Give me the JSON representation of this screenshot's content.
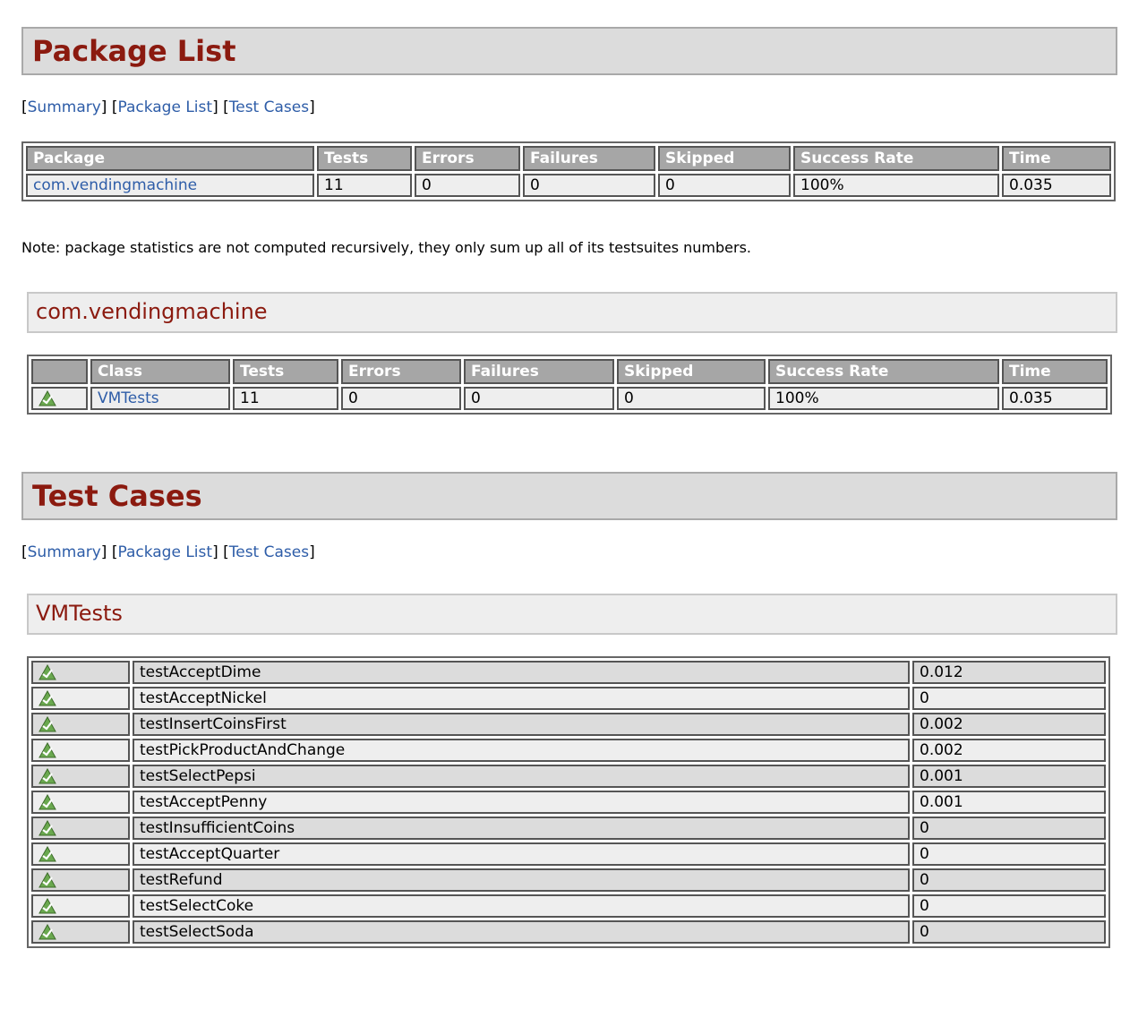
{
  "nav": {
    "summary": "Summary",
    "package_list": "Package List",
    "test_cases": "Test Cases"
  },
  "package_section": {
    "title": "Package List",
    "columns": [
      "Package",
      "Tests",
      "Errors",
      "Failures",
      "Skipped",
      "Success Rate",
      "Time"
    ],
    "rows": [
      {
        "package": "com.vendingmachine",
        "tests": "11",
        "errors": "0",
        "failures": "0",
        "skipped": "0",
        "success_rate": "100%",
        "time": "0.035"
      }
    ],
    "note": "Note: package statistics are not computed recursively, they only sum up all of its testsuites numbers."
  },
  "package_detail": {
    "title": "com.vendingmachine",
    "columns": [
      "",
      "Class",
      "Tests",
      "Errors",
      "Failures",
      "Skipped",
      "Success Rate",
      "Time"
    ],
    "rows": [
      {
        "status_icon": "pass-icon",
        "class": "VMTests",
        "tests": "11",
        "errors": "0",
        "failures": "0",
        "skipped": "0",
        "success_rate": "100%",
        "time": "0.035"
      }
    ]
  },
  "testcases_section": {
    "title": "Test Cases",
    "class_title": "VMTests",
    "rows": [
      {
        "name": "testAcceptDime",
        "time": "0.012"
      },
      {
        "name": "testAcceptNickel",
        "time": "0"
      },
      {
        "name": "testInsertCoinsFirst",
        "time": "0.002"
      },
      {
        "name": "testPickProductAndChange",
        "time": "0.002"
      },
      {
        "name": "testSelectPepsi",
        "time": "0.001"
      },
      {
        "name": "testAcceptPenny",
        "time": "0.001"
      },
      {
        "name": "testInsufficientCoins",
        "time": "0"
      },
      {
        "name": "testAcceptQuarter",
        "time": "0"
      },
      {
        "name": "testRefund",
        "time": "0"
      },
      {
        "name": "testSelectCoke",
        "time": "0"
      },
      {
        "name": "testSelectSoda",
        "time": "0"
      }
    ]
  },
  "colors": {
    "heading": "#8b1a0f",
    "link": "#2e5da8",
    "header_cell": "#a6a6a6"
  }
}
